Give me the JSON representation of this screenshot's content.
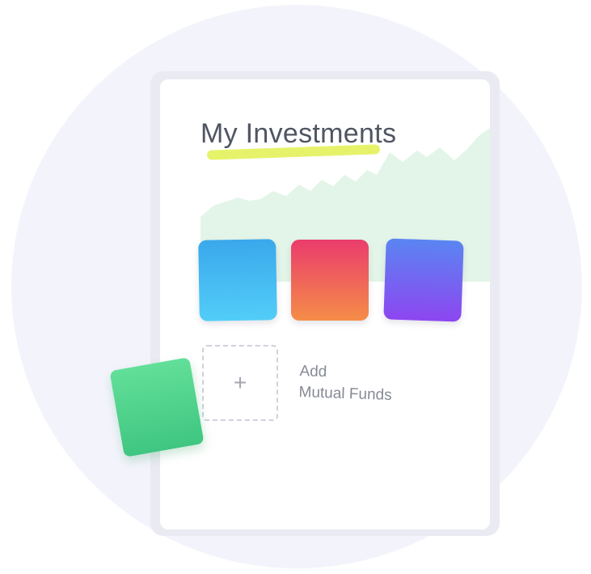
{
  "page": {
    "title": "My Investments",
    "add_line1": "Add",
    "add_line2": "Mutual Funds",
    "plus_symbol": "+"
  },
  "icons": {
    "add": "plus-icon"
  },
  "colors": {
    "title": "#4f5562",
    "highlight": "#e6f36a",
    "chart_fill": "#e3f5e8",
    "fund_blue": [
      "#3aa8ec",
      "#52cdf8"
    ],
    "fund_orange": [
      "#ea3c6c",
      "#f58d48"
    ],
    "fund_purple": [
      "#5a85f2",
      "#8d46f0"
    ],
    "green_tile": [
      "#62df98",
      "#3fc681"
    ]
  }
}
